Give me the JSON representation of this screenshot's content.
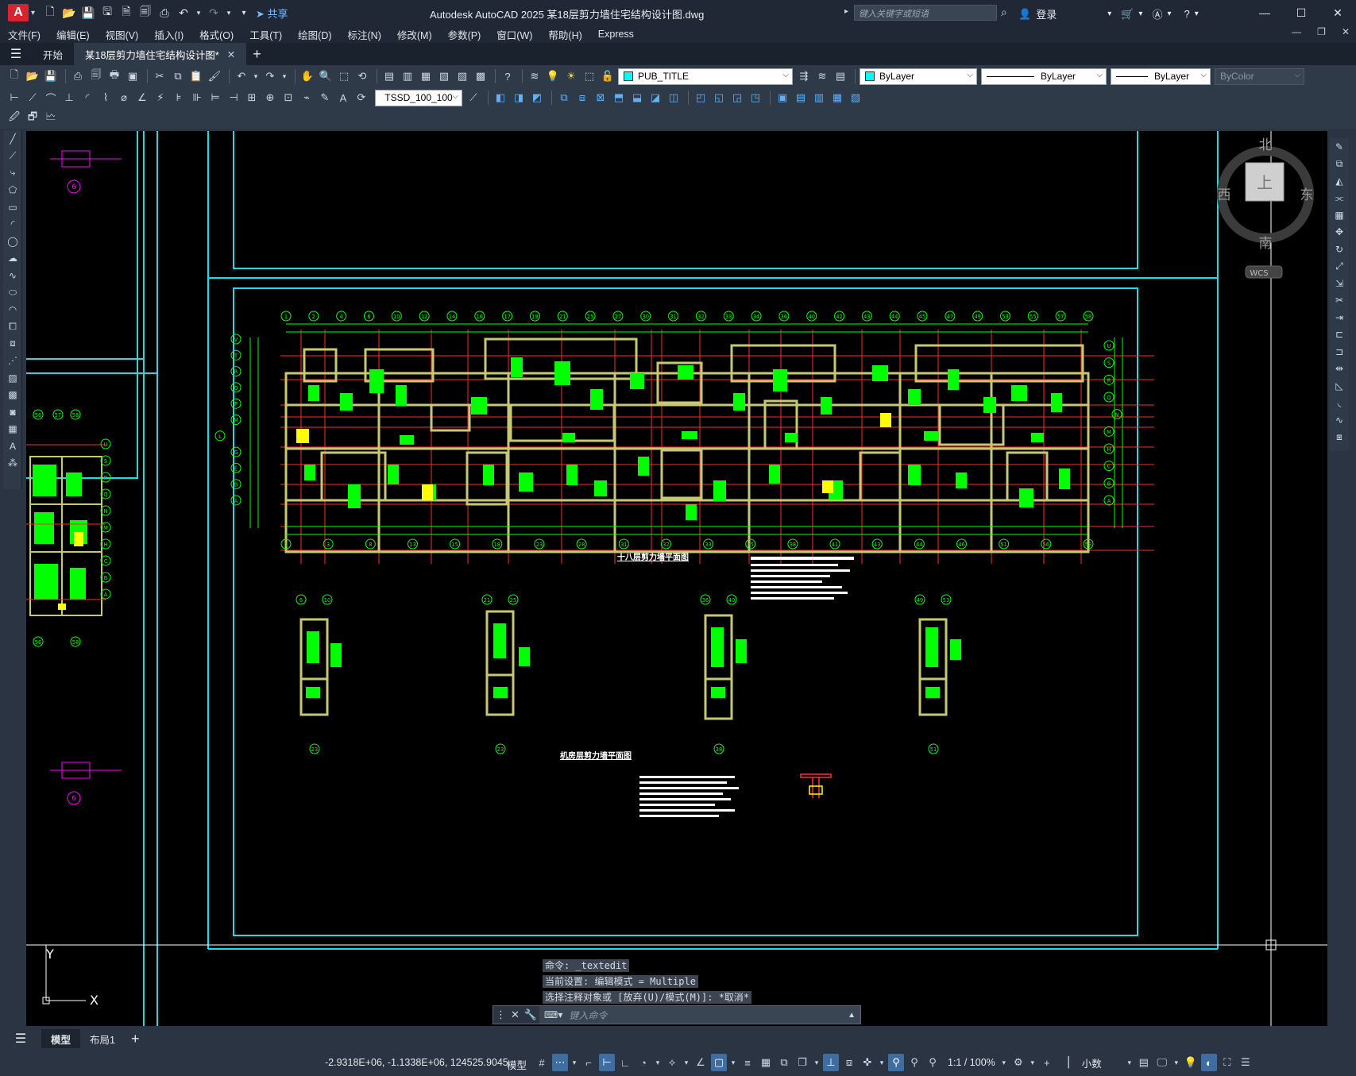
{
  "titlebar": {
    "logo": "A",
    "share_label": "共享",
    "title": "Autodesk AutoCAD 2025    某18层剪力墙住宅结构设计图.dwg",
    "search_placeholder": "键入关键字或短语",
    "login_label": "登录"
  },
  "menu": [
    "文件(F)",
    "编辑(E)",
    "视图(V)",
    "插入(I)",
    "格式(O)",
    "工具(T)",
    "绘图(D)",
    "标注(N)",
    "修改(M)",
    "参数(P)",
    "窗口(W)",
    "帮助(H)",
    "Express"
  ],
  "tabs": {
    "start": "开始",
    "file": "某18层剪力墙住宅结构设计图*"
  },
  "toolbar": {
    "layer": "PUB_TITLE",
    "color": "ByLayer",
    "linetype": "ByLayer",
    "lineweight": "ByLayer",
    "plotstyle": "ByColor",
    "dimstyle": "TSSD_100_100"
  },
  "viewcube": {
    "north": "北",
    "south": "南",
    "east": "东",
    "west": "西",
    "top": "上",
    "wcs": "WCS"
  },
  "drawing": {
    "plan_title_1": "十八层剪力墙平面图",
    "plan_title_2": "机房层剪力墙平面图",
    "axis_top": [
      "1",
      "2",
      "4",
      "6",
      "10",
      "12",
      "14",
      "16",
      "17",
      "19",
      "21",
      "25",
      "27",
      "30",
      "31",
      "32",
      "33",
      "34",
      "36",
      "40",
      "42",
      "43",
      "44",
      "45",
      "47",
      "49",
      "53",
      "55",
      "57",
      "58"
    ],
    "axis_bottom": [
      "1",
      "3",
      "8",
      "13",
      "15",
      "18",
      "23",
      "28",
      "31",
      "32",
      "33",
      "35",
      "38",
      "41",
      "43",
      "44",
      "46",
      "51",
      "56",
      "58"
    ],
    "axis_left": [
      "V",
      "T",
      "R",
      "Q",
      "P",
      "M",
      "L",
      "G",
      "E",
      "B",
      "A"
    ],
    "axis_right": [
      "U",
      "S",
      "R",
      "Q",
      "N",
      "M",
      "H",
      "C",
      "B",
      "A"
    ],
    "small_plan_labels": [
      [
        "6",
        "10",
        "23"
      ],
      [
        "21",
        "25",
        "23"
      ],
      [
        "36",
        "40",
        "38"
      ],
      [
        "49",
        "53",
        "51"
      ]
    ],
    "left_axis_marks": [
      "56",
      "57",
      "58",
      "U",
      "S",
      "R",
      "Q",
      "N",
      "M",
      "H",
      "C",
      "B",
      "A",
      "56",
      "58"
    ],
    "circle_label": "6",
    "ucs_x": "X",
    "ucs_y": "Y"
  },
  "command": {
    "history": [
      "命令: _textedit",
      "当前设置: 编辑模式 = Multiple",
      "选择注释对象或 [放弃(U)/模式(M)]: *取消*"
    ],
    "placeholder": "键入命令"
  },
  "layout_tabs": [
    "模型",
    "布局1"
  ],
  "status": {
    "coords": "-2.9318E+06, -1.1338E+06, 124525.9045",
    "model": "模型",
    "scale": "1:1 / 100%",
    "units": "小数"
  }
}
